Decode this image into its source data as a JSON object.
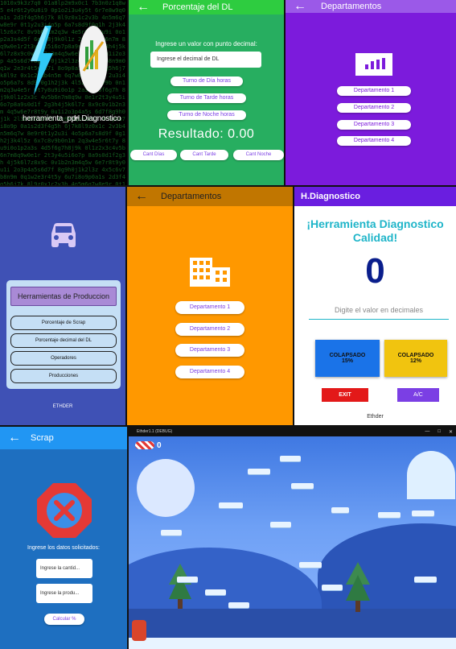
{
  "launcher": {
    "apps": [
      {
        "label": "herramienta_ppr",
        "icon": "lightning-icon"
      },
      {
        "label": "H.Diagnostico",
        "icon": "diagnostic-icon"
      }
    ]
  },
  "porcentaje": {
    "title": "Porcentaje del DL",
    "prompt": "Ingrese un valor con punto decimal:",
    "input_placeholder": "Ingrese el decimal de DL",
    "shift_buttons": [
      "Turno de Día horas",
      "Turno de Tarde horas",
      "Turno de Noche horas"
    ],
    "result": "Resultado: 0.00",
    "bottom_buttons": [
      "Cant Días",
      "Cant Tarde",
      "Cant Noche"
    ]
  },
  "departamentos_purple": {
    "title": "Departamentos",
    "buttons": [
      "Departamento 1",
      "Departamento 2",
      "Departamento 3",
      "Departamento 4"
    ]
  },
  "menu": {
    "header": "Herramientas de Produccion",
    "items": [
      "Porcentaje de Scrap",
      "Porcentaje decimal del DL",
      "Operadores",
      "Producciones"
    ],
    "footer": "ETHDER"
  },
  "departamentos_orange": {
    "title": "Departamentos",
    "buttons": [
      "Departamento 1",
      "Departamento 2",
      "Departamento 3",
      "Departamento 4"
    ]
  },
  "diagnostico": {
    "title": "H.Diagnostico",
    "heading": "¡Herramienta Diagnostico Calidad!",
    "value": "0",
    "input_placeholder": "Digite el valor en decimales",
    "card_blue": "COLAPSADO 15%",
    "card_yellow": "COLAPSADO 12%",
    "exit_label": "EXIT",
    "ac_label": "A/C",
    "footer": "Ethder",
    "colors": {
      "blue": "#1a73e8",
      "yellow": "#f1c40f",
      "red": "#e31919",
      "purple": "#7b3fe4",
      "navy": "#0a1e8c"
    }
  },
  "scrap": {
    "title": "Scrap",
    "prompt": "Ingrese los datos solicitados:",
    "input1_placeholder": "Ingrese la cantid...",
    "input2_placeholder": "Ingrese la produ...",
    "button": "Calcular %"
  },
  "game": {
    "window_title": "Ethder1.1 (DEBUG)",
    "score": "0",
    "window_controls": [
      "—",
      "□",
      "✕"
    ]
  }
}
